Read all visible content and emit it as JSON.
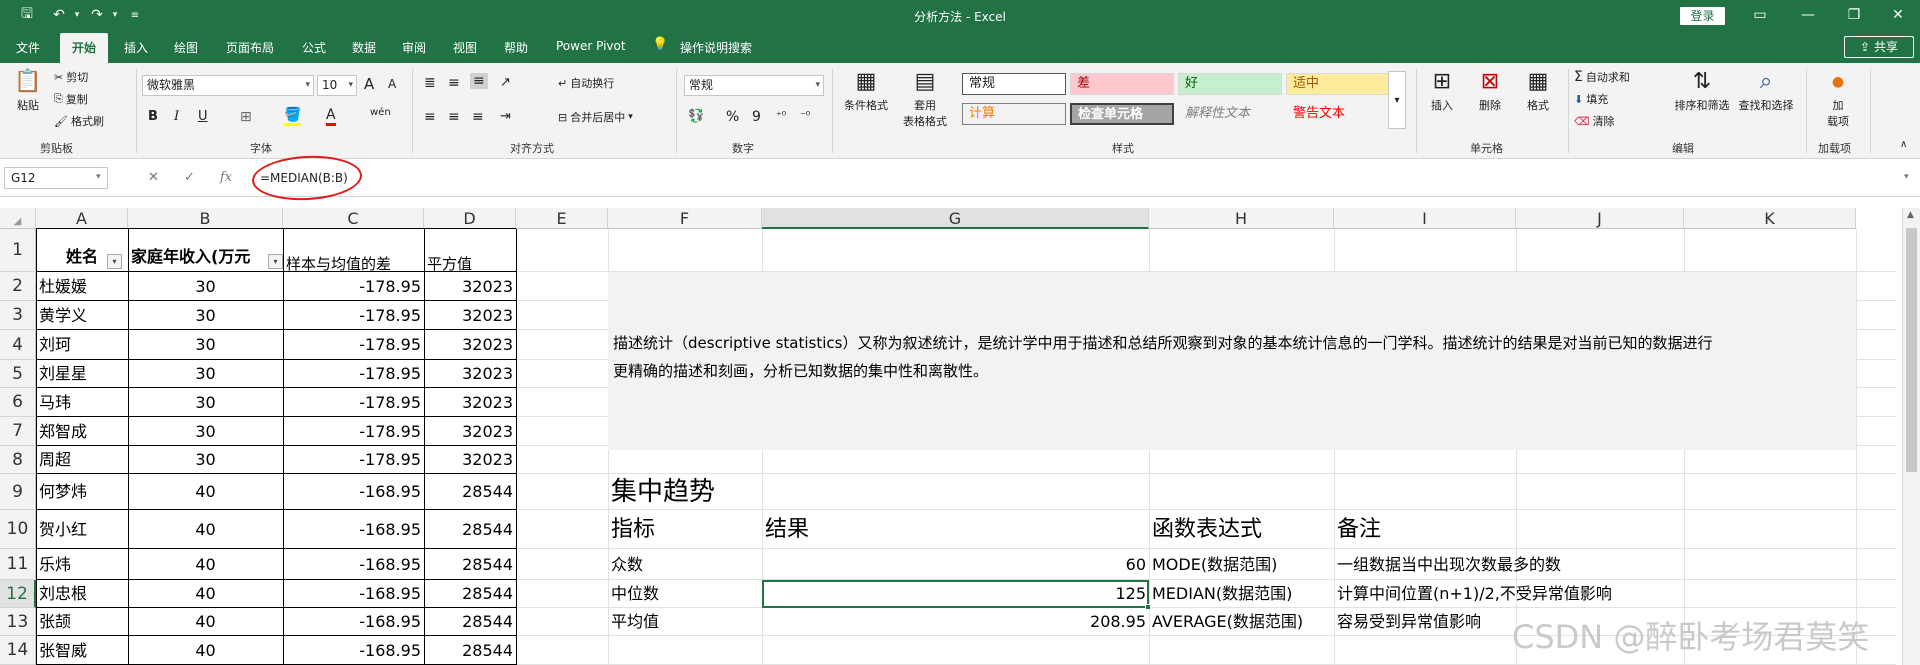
{
  "window": {
    "title": "分析方法  -  Excel",
    "login": "登录",
    "share": "共享"
  },
  "ribbon_tabs": [
    "文件",
    "开始",
    "插入",
    "绘图",
    "页面布局",
    "公式",
    "数据",
    "审阅",
    "视图",
    "帮助",
    "Power Pivot",
    "操作说明搜索"
  ],
  "ribbon": {
    "clipboard": {
      "paste": "粘贴",
      "cut": "剪切",
      "copy": "复制",
      "format_painter": "格式刷",
      "label": "剪贴板"
    },
    "font": {
      "name": "微软雅黑",
      "size": "10",
      "label": "字体",
      "bold": "B",
      "italic": "I",
      "underline": "U",
      "grow": "A",
      "shrink": "A",
      "wen": "wén"
    },
    "alignment": {
      "wrap": "自动换行",
      "merge": "合并后居中",
      "label": "对齐方式"
    },
    "number": {
      "format": "常规",
      "percent": "%",
      "comma": "9",
      "label": "数字"
    },
    "styles": {
      "conditional": "条件格式",
      "table_fmt": "套用",
      "table_fmt2": "表格格式",
      "normal": "常规",
      "bad": "差",
      "good": "好",
      "neutral": "适中",
      "calc": "计算",
      "check": "检查单元格",
      "explain": "解释性文本",
      "warn": "警告文本",
      "label": "样式"
    },
    "cells": {
      "insert": "插入",
      "delete": "删除",
      "format": "格式",
      "label": "单元格"
    },
    "editing": {
      "autosum": "自动求和",
      "fill": "填充",
      "clear": "清除",
      "sort": "排序和筛选",
      "find": "查找和选择",
      "label": "编辑"
    },
    "addins": {
      "addin": "加",
      "addin2": "载项",
      "label": "加载项"
    }
  },
  "formula_bar": {
    "name_box": "G12",
    "formula": "=MEDIAN(B:B)",
    "fx": "fx",
    "cancel": "✕",
    "enter": "✓"
  },
  "columns": [
    "A",
    "B",
    "C",
    "D",
    "E",
    "F",
    "G",
    "H",
    "I",
    "J",
    "K"
  ],
  "rows": [
    "1",
    "2",
    "3",
    "4",
    "5",
    "6",
    "7",
    "8",
    "9",
    "10",
    "11",
    "12",
    "13",
    "14"
  ],
  "headers": {
    "name": "姓名",
    "income": "家庭年收入(万元",
    "diff": "样本与均值的差",
    "sq": "平方值"
  },
  "data": [
    [
      "杜媛媛",
      "30",
      "-178.95",
      "32023"
    ],
    [
      "黄学义",
      "30",
      "-178.95",
      "32023"
    ],
    [
      "刘珂",
      "30",
      "-178.95",
      "32023"
    ],
    [
      "刘星星",
      "30",
      "-178.95",
      "32023"
    ],
    [
      "马玮",
      "30",
      "-178.95",
      "32023"
    ],
    [
      "郑智成",
      "30",
      "-178.95",
      "32023"
    ],
    [
      "周超",
      "30",
      "-178.95",
      "32023"
    ],
    [
      "何梦炜",
      "40",
      "-168.95",
      "28544"
    ],
    [
      "贺小红",
      "40",
      "-168.95",
      "28544"
    ],
    [
      "乐炜",
      "40",
      "-168.95",
      "28544"
    ],
    [
      "刘忠根",
      "40",
      "-168.95",
      "28544"
    ],
    [
      "张颉",
      "40",
      "-168.95",
      "28544"
    ],
    [
      "张智威",
      "40",
      "-168.95",
      "28544"
    ]
  ],
  "description": {
    "line1": "描述统计（descriptive statistics）又称为叙述统计，是统计学中用于描述和总结所观察到对象的基本统计信息的一门学科。描述统计的结果是对当前已知的数据进行",
    "line2": "更精确的描述和刻画，分析已知数据的集中性和离散性。"
  },
  "stats": {
    "section_title": "集中趋势",
    "headers": [
      "指标",
      "结果",
      "函数表达式",
      "备注"
    ],
    "rows": [
      [
        "众数",
        "60",
        "MODE(数据范围)",
        "一组数据当中出现次数最多的数"
      ],
      [
        "中位数",
        "125",
        "MEDIAN(数据范围)",
        "计算中间位置(n+1)/2,不受异常值影响"
      ],
      [
        "平均值",
        "208.95",
        "AVERAGE(数据范围)",
        "容易受到异常值影响"
      ]
    ]
  },
  "watermark": "CSDN @醉卧考场君莫笑",
  "colors": {
    "accent": "#217346",
    "bad_bg": "#ffc7ce",
    "bad_fg": "#9c0006",
    "good_bg": "#c6efce",
    "good_fg": "#006100",
    "neutral_bg": "#ffeb9c",
    "neutral_fg": "#9c5700",
    "calc_fg": "#fa7d00",
    "warn_fg": "#ff0000",
    "desc_bg": "#f2f2f2",
    "red_mark": "#e01b1b"
  }
}
